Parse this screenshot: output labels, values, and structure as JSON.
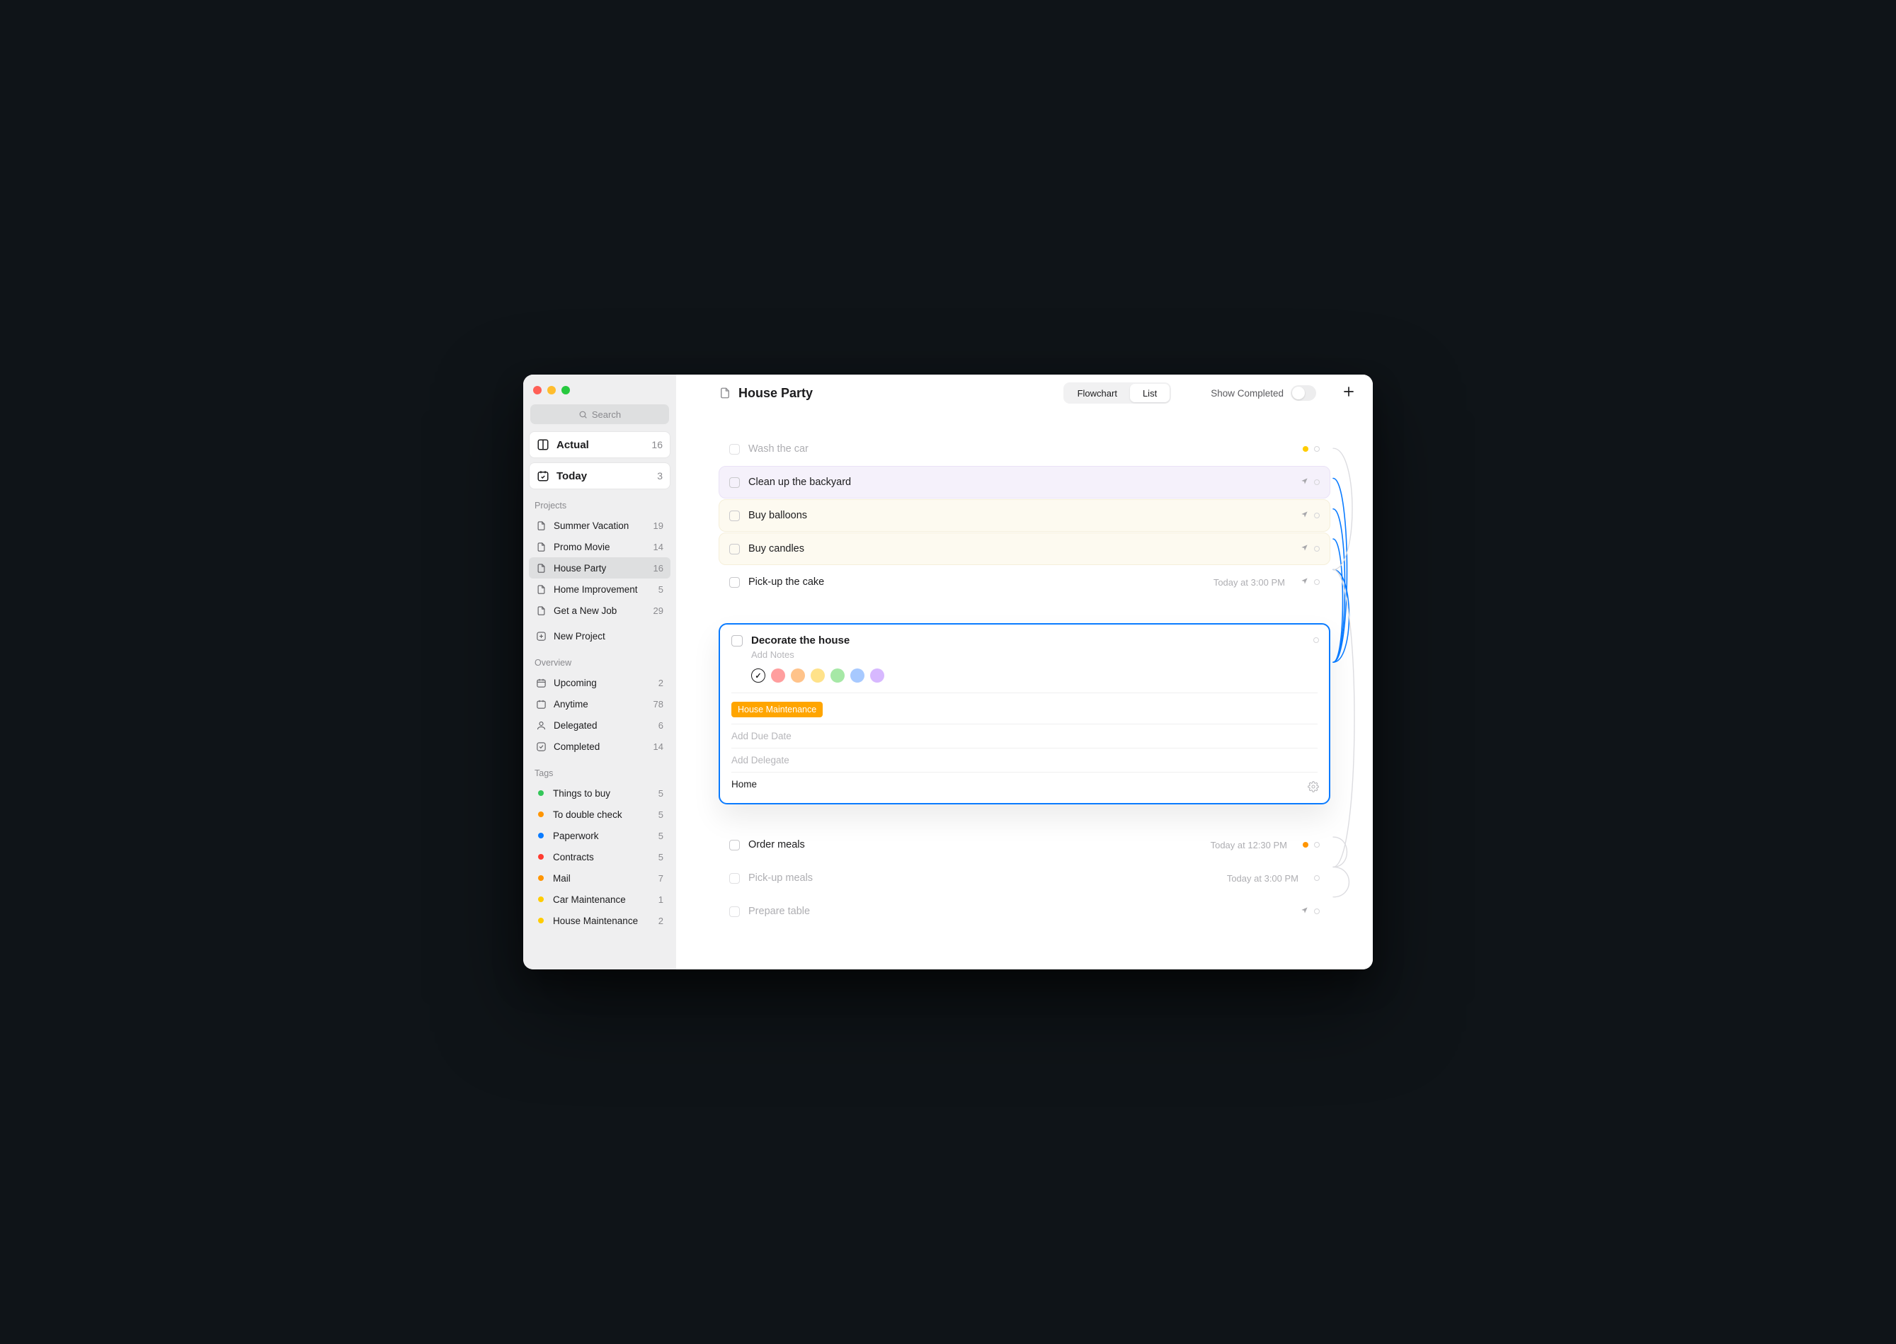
{
  "window": {
    "title": "House Party"
  },
  "sidebar": {
    "search_placeholder": "Search",
    "primary": [
      {
        "icon": "actual",
        "label": "Actual",
        "count": "16"
      },
      {
        "icon": "today",
        "label": "Today",
        "count": "3"
      }
    ],
    "projects_header": "Projects",
    "projects": [
      {
        "label": "Summer Vacation",
        "count": "19",
        "selected": false
      },
      {
        "label": "Promo Movie",
        "count": "14",
        "selected": false
      },
      {
        "label": "House Party",
        "count": "16",
        "selected": true
      },
      {
        "label": "Home Improvement",
        "count": "5",
        "selected": false
      },
      {
        "label": "Get a New Job",
        "count": "29",
        "selected": false
      }
    ],
    "new_project_label": "New Project",
    "overview_header": "Overview",
    "overview": [
      {
        "icon": "upcoming",
        "label": "Upcoming",
        "count": "2"
      },
      {
        "icon": "anytime",
        "label": "Anytime",
        "count": "78"
      },
      {
        "icon": "delegated",
        "label": "Delegated",
        "count": "6"
      },
      {
        "icon": "completed",
        "label": "Completed",
        "count": "14"
      }
    ],
    "tags_header": "Tags",
    "tags": [
      {
        "color": "#34c759",
        "label": "Things to buy",
        "count": "5"
      },
      {
        "color": "#ff9500",
        "label": "To double check",
        "count": "5"
      },
      {
        "color": "#0a7bff",
        "label": "Paperwork",
        "count": "5"
      },
      {
        "color": "#ff3b30",
        "label": "Contracts",
        "count": "5"
      },
      {
        "color": "#ff9500",
        "label": "Mail",
        "count": "7"
      },
      {
        "color": "#ffcc00",
        "label": "Car Maintenance",
        "count": "1"
      },
      {
        "color": "#ffcc00",
        "label": "House Maintenance",
        "count": "2"
      }
    ]
  },
  "topbar": {
    "segmented": {
      "flowchart": "Flowchart",
      "list": "List",
      "active": "list"
    },
    "show_completed_label": "Show Completed"
  },
  "tasks": [
    {
      "id": "t1",
      "label": "Wash the car",
      "dim": true,
      "tint": "",
      "due": "",
      "status_dot": "#ffcc00",
      "arrow": false,
      "outgoing": true
    },
    {
      "id": "t2",
      "label": "Clean up the backyard",
      "dim": false,
      "tint": "purple",
      "due": "",
      "status_dot": "",
      "arrow": true,
      "outgoing": true
    },
    {
      "id": "t3",
      "label": "Buy balloons",
      "dim": false,
      "tint": "yellow",
      "due": "",
      "status_dot": "",
      "arrow": true,
      "outgoing": true
    },
    {
      "id": "t4",
      "label": "Buy candles",
      "dim": false,
      "tint": "yellow",
      "due": "",
      "status_dot": "",
      "arrow": true,
      "outgoing": true
    },
    {
      "id": "t5",
      "label": "Pick-up the cake",
      "dim": false,
      "tint": "",
      "due": "Today at 3:00 PM",
      "status_dot": "",
      "arrow": true,
      "outgoing": true
    }
  ],
  "editor": {
    "title": "Decorate the house",
    "notes_placeholder": "Add Notes",
    "swatches": [
      {
        "kind": "none",
        "color": ""
      },
      {
        "kind": "color",
        "color": "#ff9e9e"
      },
      {
        "kind": "color",
        "color": "#ffc38a"
      },
      {
        "kind": "color",
        "color": "#ffe28a"
      },
      {
        "kind": "color",
        "color": "#a6e8a6"
      },
      {
        "kind": "color",
        "color": "#a7c9ff"
      },
      {
        "kind": "color",
        "color": "#d7b8ff"
      }
    ],
    "tag_chip": "House Maintenance",
    "due_placeholder": "Add Due Date",
    "delegate_placeholder": "Add Delegate",
    "location_value": "Home"
  },
  "tasks_after": [
    {
      "id": "t7",
      "label": "Order meals",
      "dim": false,
      "due": "Today at 12:30 PM",
      "status_dot": "#ff9500",
      "arrow": false,
      "outgoing": true
    },
    {
      "id": "t8",
      "label": "Pick-up meals",
      "dim": true,
      "due": "Today at 3:00 PM",
      "status_dot": "",
      "arrow": false,
      "outgoing": true
    },
    {
      "id": "t9",
      "label": "Prepare table",
      "dim": true,
      "due": "",
      "status_dot": "",
      "arrow": true,
      "outgoing": true
    }
  ]
}
